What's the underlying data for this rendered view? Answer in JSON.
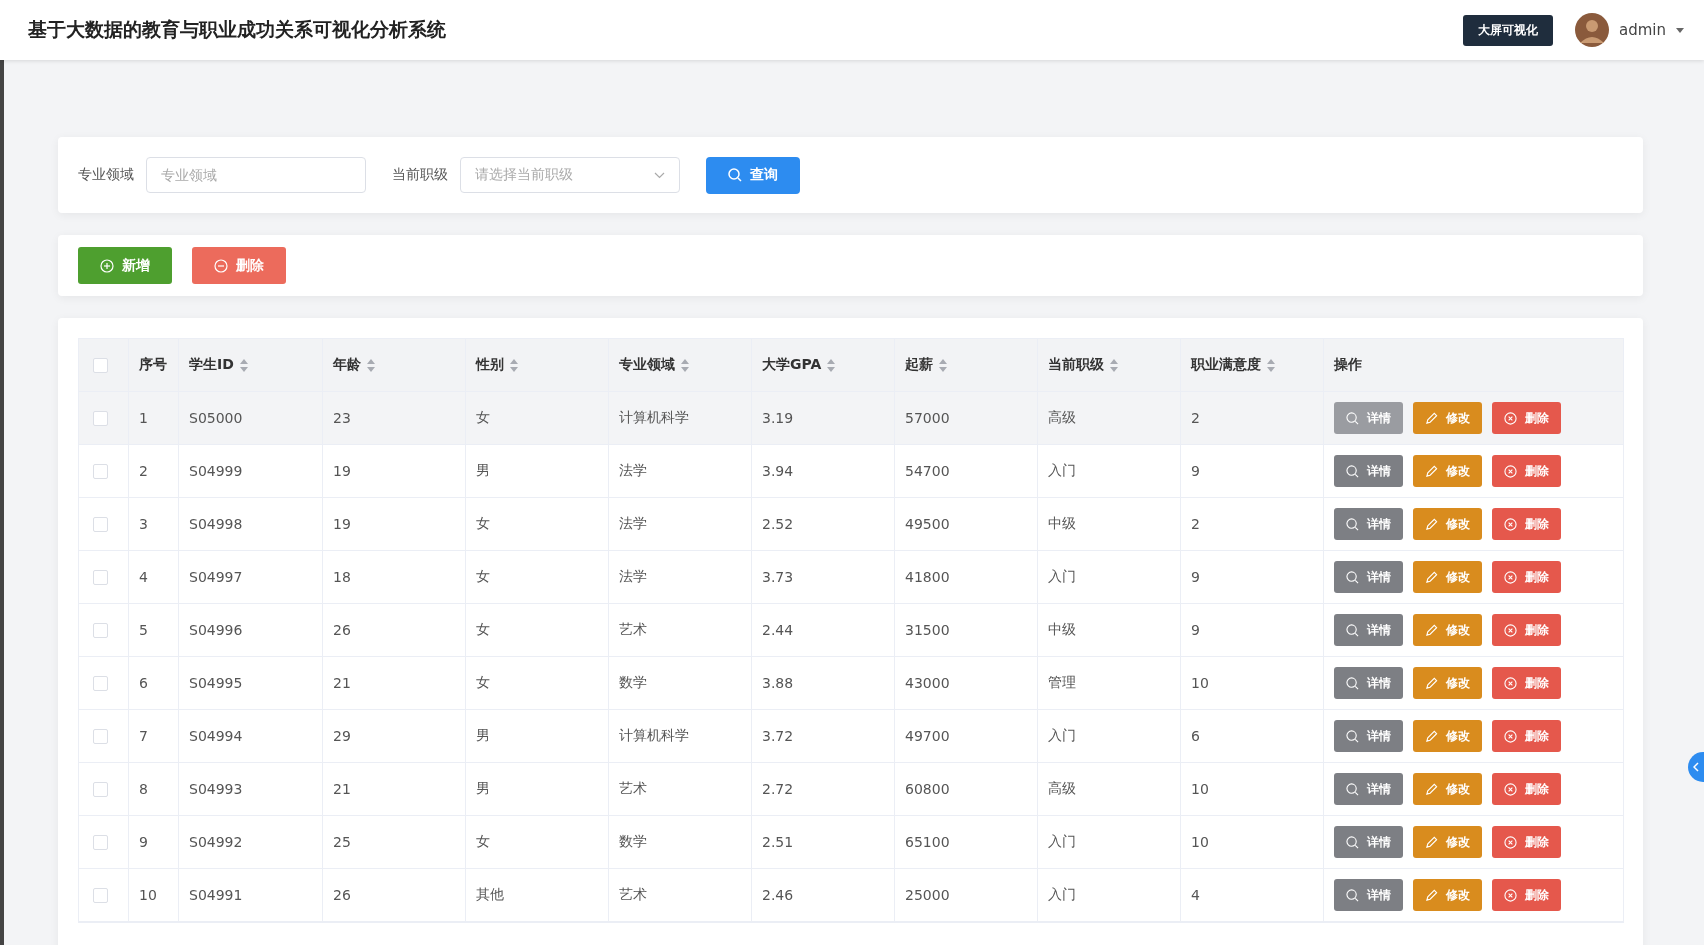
{
  "header": {
    "title": "基于大数据的教育与职业成功关系可视化分析系统",
    "screen_button": "大屏可视化",
    "user": "admin"
  },
  "filters": [
    {
      "label": "专业领域",
      "kind": "input",
      "placeholder": "专业领域"
    },
    {
      "label": "当前职级",
      "kind": "select",
      "placeholder": "请选择当前职级"
    }
  ],
  "search_button": "查询",
  "actions": [
    {
      "label": "新增",
      "kind": "add"
    },
    {
      "label": "删除",
      "kind": "delete"
    }
  ],
  "table": {
    "all_checked": false,
    "columns": [
      {
        "label": "序号",
        "sortable": false
      },
      {
        "label": "学生ID",
        "sortable": true
      },
      {
        "label": "年龄",
        "sortable": true
      },
      {
        "label": "性别",
        "sortable": true
      },
      {
        "label": "专业领域",
        "sortable": true
      },
      {
        "label": "大学GPA",
        "sortable": true
      },
      {
        "label": "起薪",
        "sortable": true
      },
      {
        "label": "当前职级",
        "sortable": true
      },
      {
        "label": "职业满意度",
        "sortable": true
      },
      {
        "label": "操作",
        "sortable": false
      }
    ],
    "rows": [
      {
        "checked": false,
        "hovered": true,
        "cells": [
          "1",
          "S05000",
          "23",
          "女",
          "计算机科学",
          "3.19",
          "57000",
          "高级",
          "2"
        ],
        "buttons": [
          {
            "label": "详情",
            "kind": "detail"
          },
          {
            "label": "修改",
            "kind": "edit"
          },
          {
            "label": "删除",
            "kind": "delete"
          }
        ]
      },
      {
        "checked": false,
        "hovered": false,
        "cells": [
          "2",
          "S04999",
          "19",
          "男",
          "法学",
          "3.94",
          "54700",
          "入门",
          "9"
        ],
        "buttons": [
          {
            "label": "详情",
            "kind": "detail"
          },
          {
            "label": "修改",
            "kind": "edit"
          },
          {
            "label": "删除",
            "kind": "delete"
          }
        ]
      },
      {
        "checked": false,
        "hovered": false,
        "cells": [
          "3",
          "S04998",
          "19",
          "女",
          "法学",
          "2.52",
          "49500",
          "中级",
          "2"
        ],
        "buttons": [
          {
            "label": "详情",
            "kind": "detail"
          },
          {
            "label": "修改",
            "kind": "edit"
          },
          {
            "label": "删除",
            "kind": "delete"
          }
        ]
      },
      {
        "checked": false,
        "hovered": false,
        "cells": [
          "4",
          "S04997",
          "18",
          "女",
          "法学",
          "3.73",
          "41800",
          "入门",
          "9"
        ],
        "buttons": [
          {
            "label": "详情",
            "kind": "detail"
          },
          {
            "label": "修改",
            "kind": "edit"
          },
          {
            "label": "删除",
            "kind": "delete"
          }
        ]
      },
      {
        "checked": false,
        "hovered": false,
        "cells": [
          "5",
          "S04996",
          "26",
          "女",
          "艺术",
          "2.44",
          "31500",
          "中级",
          "9"
        ],
        "buttons": [
          {
            "label": "详情",
            "kind": "detail"
          },
          {
            "label": "修改",
            "kind": "edit"
          },
          {
            "label": "删除",
            "kind": "delete"
          }
        ]
      },
      {
        "checked": false,
        "hovered": false,
        "cells": [
          "6",
          "S04995",
          "21",
          "女",
          "数学",
          "3.88",
          "43000",
          "管理",
          "10"
        ],
        "buttons": [
          {
            "label": "详情",
            "kind": "detail"
          },
          {
            "label": "修改",
            "kind": "edit"
          },
          {
            "label": "删除",
            "kind": "delete"
          }
        ]
      },
      {
        "checked": false,
        "hovered": false,
        "cells": [
          "7",
          "S04994",
          "29",
          "男",
          "计算机科学",
          "3.72",
          "49700",
          "入门",
          "6"
        ],
        "buttons": [
          {
            "label": "详情",
            "kind": "detail"
          },
          {
            "label": "修改",
            "kind": "edit"
          },
          {
            "label": "删除",
            "kind": "delete"
          }
        ]
      },
      {
        "checked": false,
        "hovered": false,
        "cells": [
          "8",
          "S04993",
          "21",
          "男",
          "艺术",
          "2.72",
          "60800",
          "高级",
          "10"
        ],
        "buttons": [
          {
            "label": "详情",
            "kind": "detail"
          },
          {
            "label": "修改",
            "kind": "edit"
          },
          {
            "label": "删除",
            "kind": "delete"
          }
        ]
      },
      {
        "checked": false,
        "hovered": false,
        "cells": [
          "9",
          "S04992",
          "25",
          "女",
          "数学",
          "2.51",
          "65100",
          "入门",
          "10"
        ],
        "buttons": [
          {
            "label": "详情",
            "kind": "detail"
          },
          {
            "label": "修改",
            "kind": "edit"
          },
          {
            "label": "删除",
            "kind": "delete"
          }
        ]
      },
      {
        "checked": false,
        "hovered": false,
        "cells": [
          "10",
          "S04991",
          "26",
          "其他",
          "艺术",
          "2.46",
          "25000",
          "入门",
          "4"
        ],
        "buttons": [
          {
            "label": "详情",
            "kind": "detail"
          },
          {
            "label": "修改",
            "kind": "edit"
          },
          {
            "label": "删除",
            "kind": "delete"
          }
        ]
      }
    ]
  }
}
